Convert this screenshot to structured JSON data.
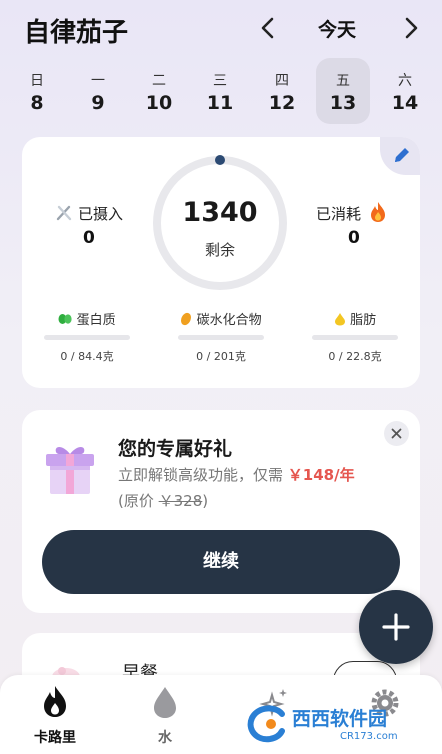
{
  "header": {
    "app_title": "自律茄子",
    "today_label": "今天"
  },
  "week": [
    {
      "weekday": "日",
      "date": "8",
      "selected": false
    },
    {
      "weekday": "一",
      "date": "9",
      "selected": false
    },
    {
      "weekday": "二",
      "date": "10",
      "selected": false
    },
    {
      "weekday": "三",
      "date": "11",
      "selected": false
    },
    {
      "weekday": "四",
      "date": "12",
      "selected": false
    },
    {
      "weekday": "五",
      "date": "13",
      "selected": true
    },
    {
      "weekday": "六",
      "date": "14",
      "selected": false
    }
  ],
  "summary": {
    "intake_label": "已摄入",
    "intake_value": "0",
    "remaining_value": "1340",
    "remaining_label": "剩余",
    "burned_label": "已消耗",
    "burned_value": "0",
    "ring_progress": 0,
    "macros": [
      {
        "label": "蛋白质",
        "value": "0 / 84.4克",
        "progress": 0,
        "icon": "bean-icon",
        "color": "#2fae3f"
      },
      {
        "label": "碳水化合物",
        "value": "0 / 201克",
        "progress": 0,
        "icon": "grain-icon",
        "color": "#f0a020"
      },
      {
        "label": "脂肪",
        "value": "0 / 22.8克",
        "progress": 0,
        "icon": "oil-drop-icon",
        "color": "#f3c623"
      }
    ]
  },
  "promo": {
    "title": "您的专属好礼",
    "line1": "立即解锁高级功能，仅需",
    "price": "￥148/年",
    "orig_prefix": "(原价",
    "orig_price": "￥328",
    "orig_suffix": ")",
    "continue_label": "继续"
  },
  "meal": {
    "title": "早餐"
  },
  "tabs": [
    {
      "label": "卡路里",
      "icon": "flame-icon",
      "active": true
    },
    {
      "label": "水",
      "icon": "water-drop-icon",
      "active": false
    },
    {
      "label": "",
      "icon": "sparkle-icon",
      "active": false
    },
    {
      "label": "",
      "icon": "gear-icon",
      "active": false
    }
  ],
  "watermark": {
    "text": "西西软件园",
    "sub": "CR173.com"
  },
  "colors": {
    "accent": "#263445",
    "price": "#e5564f",
    "ring_track": "#e8e8ec",
    "ring_dot": "#2c4a73",
    "selected_day": "#dcdae6"
  }
}
